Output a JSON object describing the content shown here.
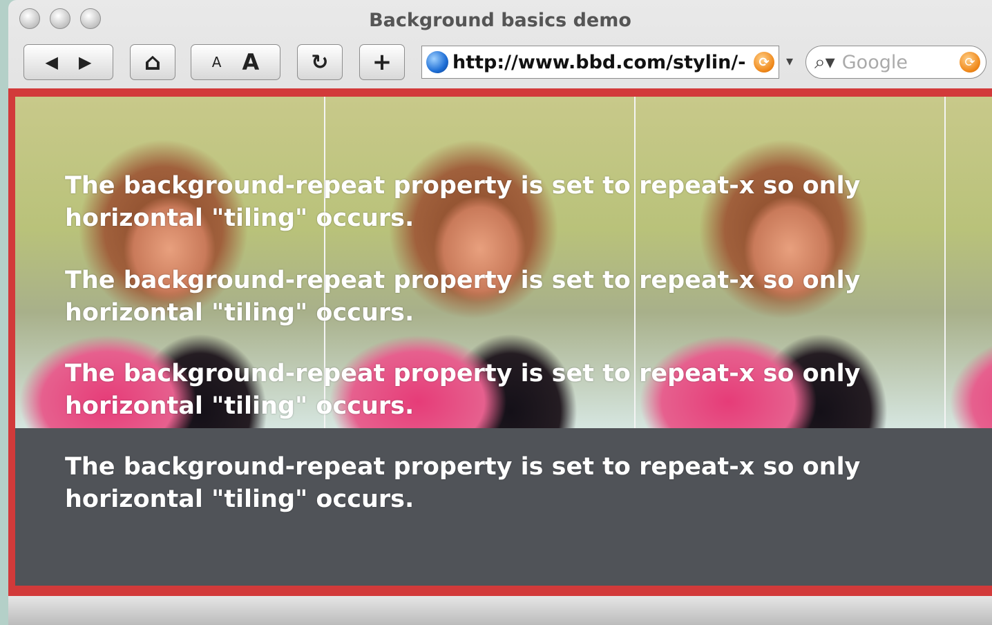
{
  "window": {
    "title": "Background basics demo"
  },
  "toolbar": {
    "back": "◀",
    "forward": "▶",
    "home": "⌂",
    "text_smaller": "A",
    "text_larger": "A",
    "reload": "↻",
    "add_bookmark": "+",
    "url": "http://www.bbd.com/stylin/-",
    "url_menu": "▾",
    "search_placeholder": "Google"
  },
  "content": {
    "paragraphs": [
      "The background-repeat property is set to repeat-x so only horizontal \"tiling\" occurs.",
      "The background-repeat property is set to repeat-x so only horizontal \"tiling\" occurs.",
      "The background-repeat property is set to repeat-x so only horizontal \"tiling\" occurs.",
      "The background-repeat property is set to repeat-x so only horizontal \"tiling\" occurs."
    ]
  },
  "icons": {
    "back": "back-arrow-icon",
    "forward": "forward-arrow-icon",
    "home": "home-icon",
    "reload": "reload-icon",
    "site": "globe-icon",
    "rss": "rss-icon",
    "search": "magnifier-icon"
  },
  "colors": {
    "desktop": "#b4d0c8",
    "content_border": "#d23a3a",
    "content_bg": "#505358",
    "text": "#ffffff"
  }
}
